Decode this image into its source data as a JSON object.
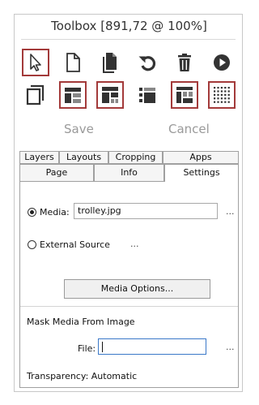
{
  "window": {
    "title": "Toolbox [891,72 @ 100%]"
  },
  "tools": {
    "row1": [
      "select-arrow-icon",
      "new-page-icon",
      "copy-page-icon",
      "undo-icon",
      "delete-icon",
      "play-icon"
    ],
    "row2": [
      "page-layout-icon",
      "layout-top-icon",
      "layout-split-icon",
      "layout-center-icon",
      "layout-grid-icon",
      "dot-grid-icon"
    ],
    "selected": [
      "select-arrow-icon",
      "layout-top-icon",
      "layout-split-icon",
      "layout-grid-icon",
      "dot-grid-icon"
    ]
  },
  "actions": {
    "save_label": "Save",
    "cancel_label": "Cancel"
  },
  "tabs": {
    "row_back": [
      "Layers",
      "Layouts",
      "Cropping",
      "Apps"
    ],
    "row_front": [
      "Page",
      "Info",
      "Settings"
    ],
    "active": "Settings"
  },
  "settings": {
    "media_label": "Media:",
    "media_value": "trolley.jpg",
    "media_selected": true,
    "external_label": "External Source",
    "ellipsis": "...",
    "media_options_label": "Media Options...",
    "mask_heading": "Mask Media From Image",
    "file_label": "File:",
    "file_value": "",
    "transparency_label": "Transparency: Automatic"
  },
  "colors": {
    "selection_border": "#a33a3a",
    "icon_fill": "#333333",
    "disabled_text": "#9a9a9a"
  }
}
